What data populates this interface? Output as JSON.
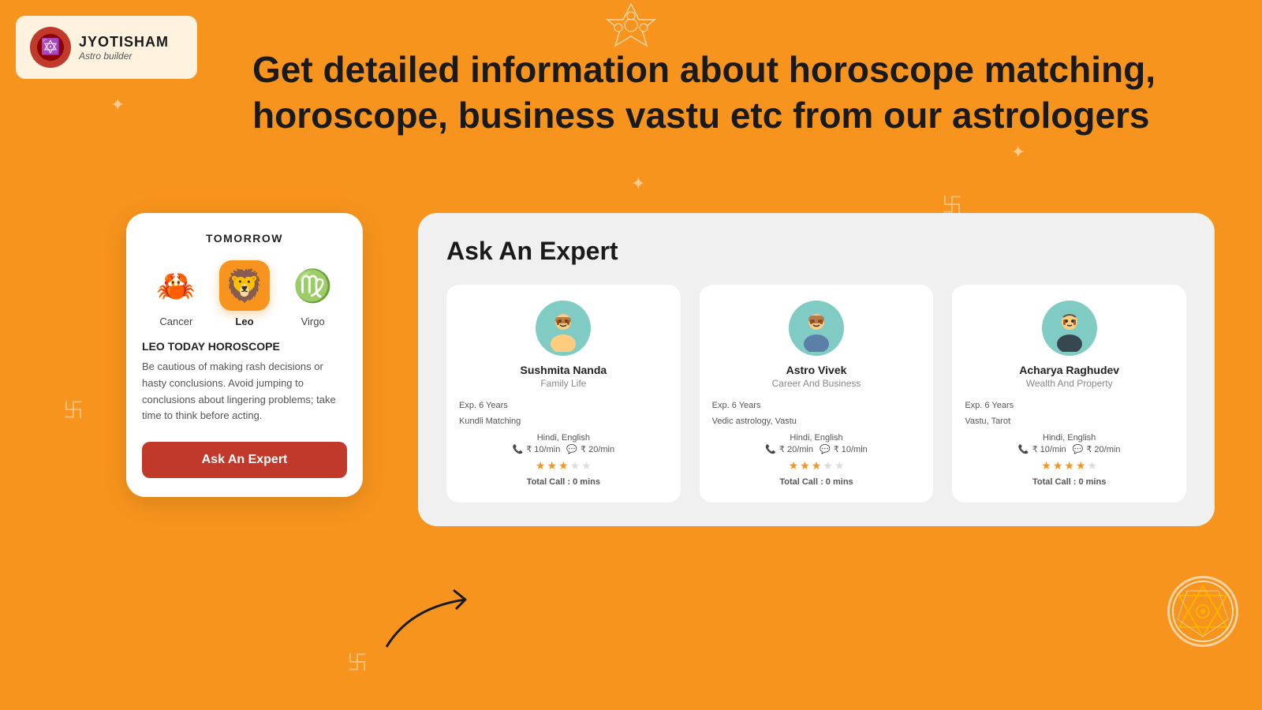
{
  "logo": {
    "title": "JYOTISHAM",
    "subtitle": "Astro builder",
    "icon": "🔮"
  },
  "hero": {
    "text": "Get detailed information about horoscope matching, horoscope, business vastu etc from our astrologers"
  },
  "phone_card": {
    "header": "TOMORROW",
    "zodiacs": [
      {
        "name": "Cancer",
        "emoji": "🦀",
        "selected": false
      },
      {
        "name": "Leo",
        "emoji": "🦁",
        "selected": true
      },
      {
        "name": "Virgo",
        "emoji": "♍",
        "selected": false
      }
    ],
    "horoscope_title": "LEO TODAY HOROSCOPE",
    "horoscope_text": "Be cautious of making rash decisions or hasty conclusions. Avoid jumping to conclusions about lingering problems; take time to think before acting.",
    "ask_btn": "Ask An Expert"
  },
  "expert_panel": {
    "title": "Ask An Expert",
    "experts": [
      {
        "name": "Sushmita Nanda",
        "specialty": "Family Life",
        "exp": "Exp. 6 Years",
        "skills": "Kundli Matching",
        "lang": "Hindi, English",
        "call_price": "₹ 10/min",
        "chat_price": "₹ 20/min",
        "stars": 3,
        "total_stars": 5,
        "total_call": "Total Call : 0 mins",
        "avatar": "👩"
      },
      {
        "name": "Astro Vivek",
        "specialty": "Career And Business",
        "exp": "Exp. 6 Years",
        "skills": "Vedic astrology, Vastu",
        "lang": "Hindi, English",
        "call_price": "₹ 20/min",
        "chat_price": "₹ 10/min",
        "stars": 3,
        "total_stars": 5,
        "total_call": "Total Call : 0 mins",
        "avatar": "🧑"
      },
      {
        "name": "Acharya Raghudev",
        "specialty": "Wealth And Property",
        "exp": "Exp. 6 Years",
        "skills": "Vastu, Tarot",
        "lang": "Hindi, English",
        "call_price": "₹ 10/min",
        "chat_price": "₹ 20/min",
        "stars": 4,
        "total_stars": 5,
        "total_call": "Total Call : 0 mins",
        "avatar": "🧔"
      }
    ]
  }
}
